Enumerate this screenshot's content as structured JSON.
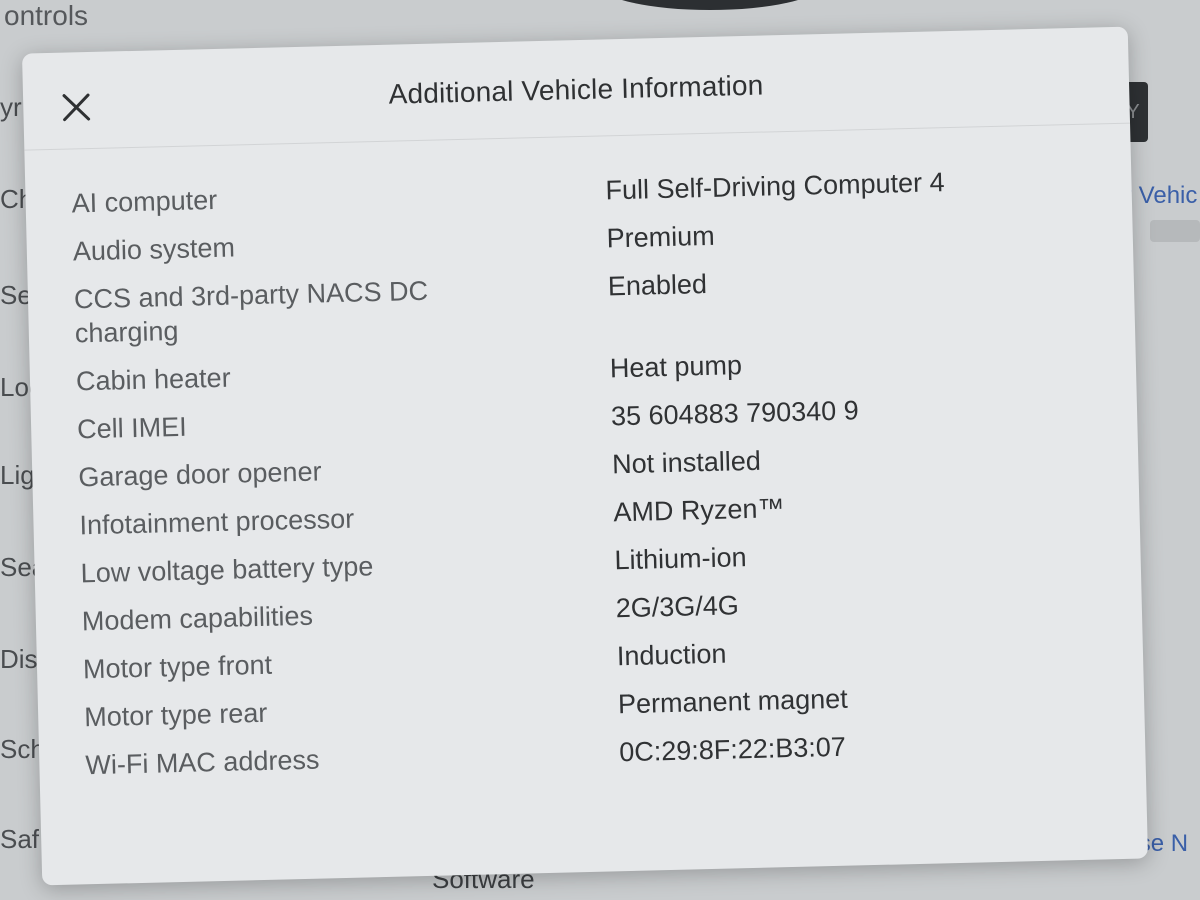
{
  "background": {
    "title_fragment": "ontrols",
    "side_items": [
      "yr",
      "Cha",
      "Sel",
      "Loc",
      "Lig",
      "Sea",
      "Dis",
      "Sch",
      "Saf"
    ],
    "button_fragment": "Y",
    "link_right_fragment": "r Vehic",
    "bottom_label": "Software",
    "release_link": "Release N"
  },
  "modal": {
    "title": "Additional Vehicle Information",
    "close_icon": "close-icon",
    "rows": [
      {
        "label": "AI computer",
        "value": "Full Self-Driving Computer 4"
      },
      {
        "label": "Audio system",
        "value": "Premium"
      },
      {
        "label": "CCS and 3rd-party NACS DC charging",
        "value": "Enabled"
      },
      {
        "label": "Cabin heater",
        "value": "Heat pump"
      },
      {
        "label": "Cell IMEI",
        "value": "35 604883 790340 9"
      },
      {
        "label": "Garage door opener",
        "value": "Not installed"
      },
      {
        "label": "Infotainment processor",
        "value": "AMD Ryzen™"
      },
      {
        "label": "Low voltage battery type",
        "value": "Lithium-ion"
      },
      {
        "label": "Modem capabilities",
        "value": "2G/3G/4G"
      },
      {
        "label": "Motor type front",
        "value": "Induction"
      },
      {
        "label": "Motor type rear",
        "value": "Permanent magnet"
      },
      {
        "label": "Wi-Fi MAC address",
        "value": "0C:29:8F:22:B3:07"
      }
    ]
  },
  "colors": {
    "modal_bg": "#e6e8ea",
    "screen_bg": "#c9ccce",
    "link": "#3a5fa8"
  }
}
